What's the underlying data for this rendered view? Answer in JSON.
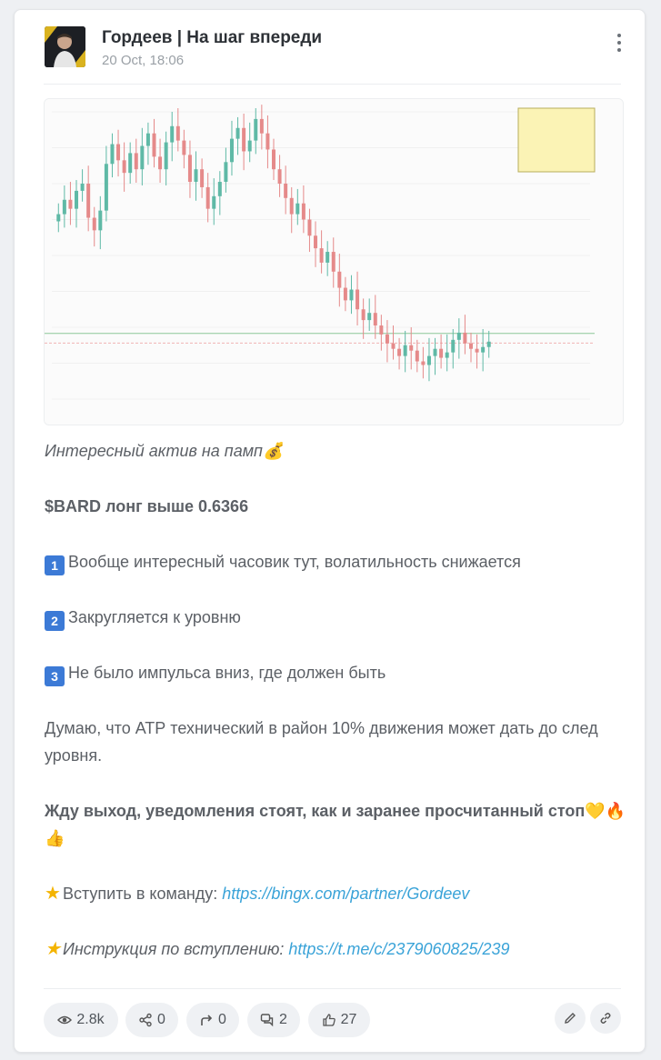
{
  "channel": {
    "name": "Гордеев | На шаг впереди",
    "date": "20 Oct, 18:06"
  },
  "post": {
    "line1": "Интересный актив на памп",
    "line1_emoji": "💰",
    "line2": "$BARD лонг выше 0.6366",
    "point1_num": "1",
    "point1": "Вообще интересный часовик тут, волатильность снижается",
    "point2_num": "2",
    "point2": "Закругляется к уровню",
    "point3_num": "3",
    "point3": "Не было импульса вниз, где должен быть",
    "para_atr": "Думаю, что АТР технический в район 10% движения может дать до след уровня.",
    "para_wait": "Жду выход, уведомления стоят, как и заранее просчитанный стоп",
    "para_wait_emoji": "💛🔥👍",
    "join_label": "Вступить в команду: ",
    "join_url": "https://bingx.com/partner/Gordeev",
    "instr_label": "Инструкция по вступлению: ",
    "instr_url": "https://t.me/c/2379060825/239"
  },
  "footer": {
    "views": "2.8k",
    "shares": "0",
    "forwards": "0",
    "comments": "2",
    "likes": "27"
  },
  "icons": [
    "avatar",
    "more-vertical-icon",
    "eye-icon",
    "share-icon",
    "forward-icon",
    "comments-icon",
    "thumbs-up-icon",
    "edit-icon",
    "link-icon",
    "star-icon"
  ],
  "colors": {
    "link": "#3aa3d8",
    "badge": "#3c7ad6",
    "bull_candle": "#5fb9a6",
    "bear_candle": "#e58a8a"
  },
  "chart_data": {
    "type": "candlestick",
    "title": "",
    "values": [
      0.703,
      0.711,
      0.706,
      0.716,
      0.72,
      0.701,
      0.694,
      0.705,
      0.731,
      0.742,
      0.733,
      0.726,
      0.737,
      0.728,
      0.741,
      0.748,
      0.735,
      0.728,
      0.743,
      0.752,
      0.744,
      0.736,
      0.721,
      0.728,
      0.718,
      0.706,
      0.713,
      0.721,
      0.732,
      0.745,
      0.751,
      0.738,
      0.744,
      0.756,
      0.748,
      0.739,
      0.728,
      0.72,
      0.712,
      0.703,
      0.709,
      0.7,
      0.691,
      0.684,
      0.676,
      0.682,
      0.671,
      0.662,
      0.655,
      0.661,
      0.65,
      0.644,
      0.648,
      0.641,
      0.636,
      0.631,
      0.628,
      0.624,
      0.63,
      0.627,
      0.621,
      0.619,
      0.624,
      0.628,
      0.623,
      0.626,
      0.633,
      0.637,
      0.631,
      0.628,
      0.626,
      0.629,
      0.632
    ],
    "levels": [
      0.6366,
      0.6312
    ],
    "ylim": [
      0.6,
      0.76
    ]
  }
}
